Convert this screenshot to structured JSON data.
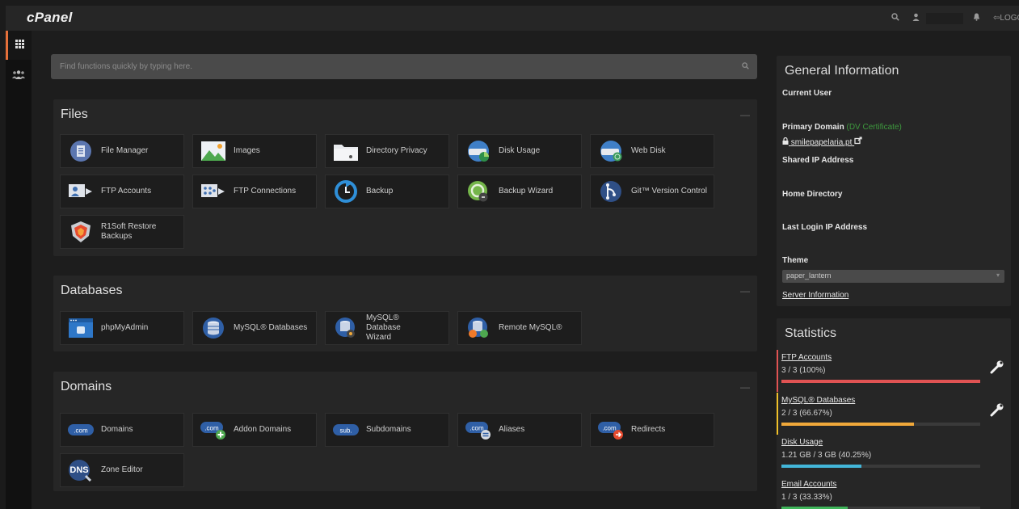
{
  "app": {
    "logo": "cPanel"
  },
  "topbar": {
    "logout_label": "LOGOUT"
  },
  "search": {
    "placeholder": "Find functions quickly by typing here."
  },
  "files": {
    "title": "Files",
    "items": [
      {
        "label": "File Manager",
        "icon": "file-manager-icon"
      },
      {
        "label": "Images",
        "icon": "images-icon"
      },
      {
        "label": "Directory Privacy",
        "icon": "folder-icon"
      },
      {
        "label": "Disk Usage",
        "icon": "disk-usage-icon"
      },
      {
        "label": "Web Disk",
        "icon": "web-disk-icon"
      },
      {
        "label": "FTP Accounts",
        "icon": "ftp-accounts-icon"
      },
      {
        "label": "FTP Connections",
        "icon": "ftp-connections-icon"
      },
      {
        "label": "Backup",
        "icon": "backup-icon"
      },
      {
        "label": "Backup Wizard",
        "icon": "backup-wizard-icon"
      },
      {
        "label": "Git™ Version Control",
        "icon": "git-icon"
      },
      {
        "label": "R1Soft Restore Backups",
        "icon": "r1soft-icon"
      }
    ]
  },
  "databases": {
    "title": "Databases",
    "items": [
      {
        "label": "phpMyAdmin",
        "icon": "phpmyadmin-icon"
      },
      {
        "label": "MySQL® Databases",
        "icon": "mysql-databases-icon"
      },
      {
        "label": "MySQL® Database Wizard",
        "icon": "mysql-wizard-icon"
      },
      {
        "label": "Remote MySQL®",
        "icon": "remote-mysql-icon"
      }
    ]
  },
  "domains": {
    "title": "Domains",
    "items": [
      {
        "label": "Domains",
        "icon": "domains-icon",
        "badge": ".com"
      },
      {
        "label": "Addon Domains",
        "icon": "addon-domains-icon",
        "badge": ".com"
      },
      {
        "label": "Subdomains",
        "icon": "subdomains-icon",
        "badge": "sub."
      },
      {
        "label": "Aliases",
        "icon": "aliases-icon",
        "badge": ".com"
      },
      {
        "label": "Redirects",
        "icon": "redirects-icon",
        "badge": ".com"
      },
      {
        "label": "Zone Editor",
        "icon": "zone-editor-icon",
        "badge": "DNS"
      }
    ]
  },
  "general": {
    "title": "General Information",
    "current_user": "Current User",
    "primary_domain": "Primary Domain",
    "dv_certificate": "(DV Certificate)",
    "domain": "smilepapelaria.pt",
    "shared_ip": "Shared IP Address",
    "home_directory": "Home Directory",
    "last_login_ip": "Last Login IP Address",
    "theme_label": "Theme",
    "theme_value": "paper_lantern",
    "server_info": "Server Information"
  },
  "statistics": {
    "title": "Statistics",
    "items": [
      {
        "label": "FTP Accounts",
        "value": "3 / 3  (100%)",
        "fraction": 1.0,
        "color": "#e05353",
        "accent": "#e05353"
      },
      {
        "label": "MySQL® Databases",
        "value": "2 / 3  (66.67%)",
        "fraction": 0.6667,
        "color": "#f0a83a",
        "accent": "#f0c02a"
      },
      {
        "label": "Disk Usage",
        "value": "1.21 GB / 3 GB  (40.25%)",
        "fraction": 0.4025,
        "color": "#43b6d9",
        "accent": ""
      },
      {
        "label": "Email Accounts",
        "value": "1 / 3  (33.33%)",
        "fraction": 0.3333,
        "color": "#3fb55a",
        "accent": ""
      }
    ]
  },
  "colors": {
    "accent": "#e5703a",
    "panel": "#262626",
    "background": "#1d1d1d"
  }
}
